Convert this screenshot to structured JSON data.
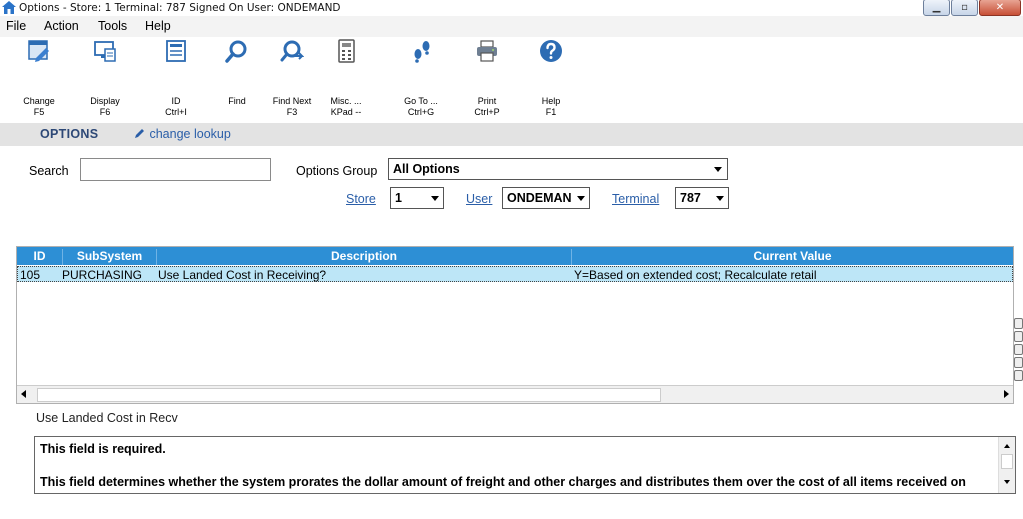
{
  "window": {
    "title": "Options  -  Store: 1  Terminal: 787  Signed On User: ONDEMAND",
    "buttons": {
      "minimize": "▁",
      "maximize": "▫",
      "close": "✕"
    }
  },
  "menu": {
    "items": [
      "File",
      "Action",
      "Tools",
      "Help"
    ]
  },
  "toolbar": {
    "buttons": [
      {
        "label": "Change",
        "shortcut": "F5",
        "icon": "change-icon"
      },
      {
        "label": "Display",
        "shortcut": "F6",
        "icon": "display-icon"
      },
      {
        "label": "ID",
        "shortcut": "Ctrl+I",
        "icon": "id-card-icon"
      },
      {
        "label": "Find",
        "shortcut": "",
        "icon": "magnifier-icon"
      },
      {
        "label": "Find Next",
        "shortcut": "F3",
        "icon": "find-next-icon"
      },
      {
        "label": "Misc. ...",
        "shortcut": "KPad --",
        "icon": "keypad-icon"
      },
      {
        "label": "Go To ...",
        "shortcut": "Ctrl+G",
        "icon": "footsteps-icon"
      },
      {
        "label": "Print",
        "shortcut": "Ctrl+P",
        "icon": "printer-icon"
      },
      {
        "label": "Help",
        "shortcut": "F1",
        "icon": "help-icon"
      }
    ]
  },
  "header": {
    "title": "OPTIONS",
    "lookup_link": "change lookup"
  },
  "filters": {
    "search_label": "Search",
    "search_value": "",
    "options_group_label": "Options Group",
    "options_group_value": "All Options",
    "store_label": "Store",
    "store_value": "1",
    "user_label": "User",
    "user_value": "ONDEMAN",
    "terminal_label": "Terminal",
    "terminal_value": "787"
  },
  "grid": {
    "columns": [
      "ID",
      "SubSystem",
      "Description",
      "Current Value"
    ],
    "rows": [
      {
        "id": "105",
        "subsystem": "PURCHASING",
        "description": "Use Landed Cost in Receiving?",
        "current_value": "Y=Based on extended cost; Recalculate retail"
      }
    ]
  },
  "detail": {
    "label": "Use Landed Cost in Recv",
    "line1": "This field is required.",
    "line2": "This field determines whether the system prorates the dollar amount of freight and other charges and distributes them over the cost of all items received on"
  },
  "colors": {
    "header_blue": "#2d8fd5",
    "selected_row": "#bde6f7",
    "link_blue": "#2a5ea8",
    "title_navy": "#2d4876"
  }
}
